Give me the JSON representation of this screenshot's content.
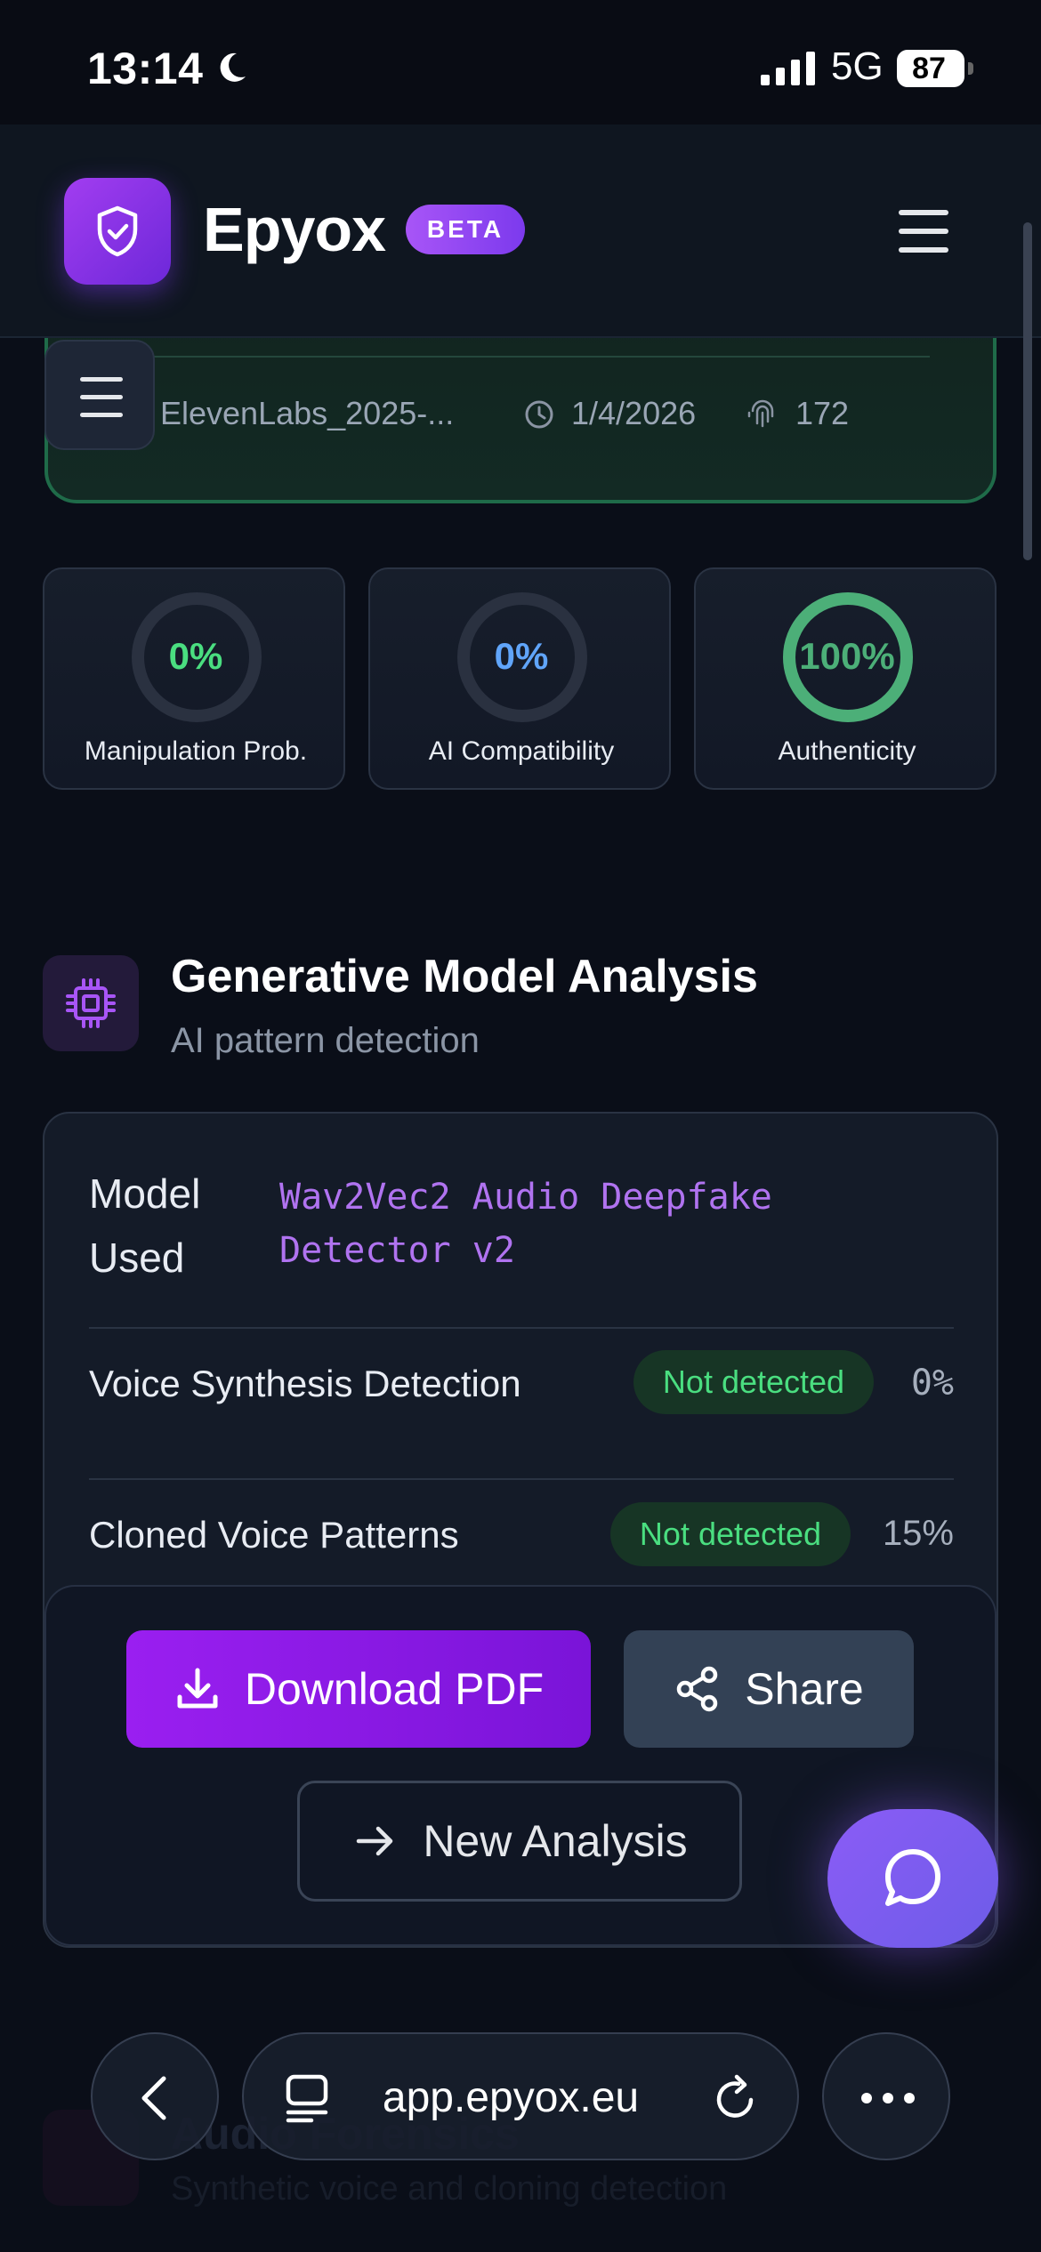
{
  "status_bar": {
    "time": "13:14",
    "network": "5G",
    "battery": "87"
  },
  "header": {
    "brand": "Epyox",
    "badge": "BETA",
    "accent": "#7c3aed"
  },
  "report": {
    "file_name": "ElevenLabs_2025-...",
    "date": "1/4/2026",
    "count": "172",
    "border_color": "#1f6b49"
  },
  "metrics": [
    {
      "value": "0%",
      "label": "Manipulation Prob.",
      "fraction": 0,
      "color": "#4ade80"
    },
    {
      "value": "0%",
      "label": "AI Compatibility",
      "fraction": 0,
      "color": "#60a5fa"
    },
    {
      "value": "100%",
      "label": "Authenticity",
      "fraction": 1,
      "color": "#4caf78"
    }
  ],
  "section": {
    "title": "Generative Model Analysis",
    "subtitle": "AI pattern detection",
    "icon": "cpu-chip-icon"
  },
  "analysis": {
    "model_label": "Model Used",
    "model_value": "Wav2Vec2 Audio Deepfake Detector v2",
    "rows": [
      {
        "label": "Voice Synthesis Detection",
        "status": "Not detected",
        "percent": "0%"
      },
      {
        "label": "Cloned Voice Patterns",
        "status": "Not detected",
        "percent": "15%"
      }
    ]
  },
  "actions": {
    "download": "Download PDF",
    "share": "Share",
    "new_analysis": "New Analysis"
  },
  "next_section": {
    "title": "Audio Forensics",
    "subtitle": "Synthetic voice and cloning detection"
  },
  "browser": {
    "url": "app.epyox.eu"
  }
}
